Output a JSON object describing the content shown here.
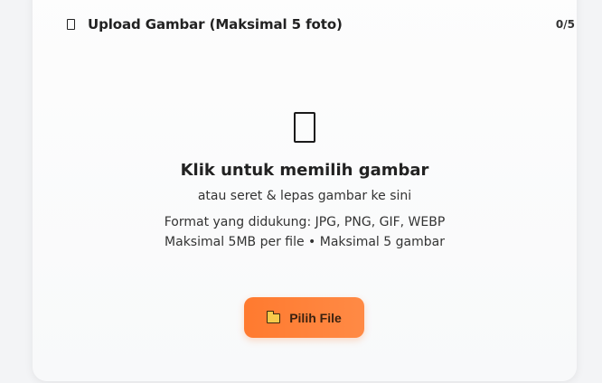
{
  "upload": {
    "title": "Upload Gambar (Maksimal 5 foto)",
    "counter": "0/5",
    "header_icon": "image-icon"
  },
  "dropzone": {
    "icon": "image-icon",
    "title": "Klik untuk memilih gambar",
    "subtitle": "atau seret & lepas gambar ke sini",
    "formats": "Format yang didukung: JPG, PNG, GIF, WEBP",
    "limits": "Maksimal 5MB per file • Maksimal 5 gambar"
  },
  "button": {
    "icon": "folder-icon",
    "label": "Pilih File"
  },
  "colors": {
    "button_start": "#ff7a2f",
    "button_end": "#ff8a45",
    "card_bg": "#fdfdfd"
  }
}
